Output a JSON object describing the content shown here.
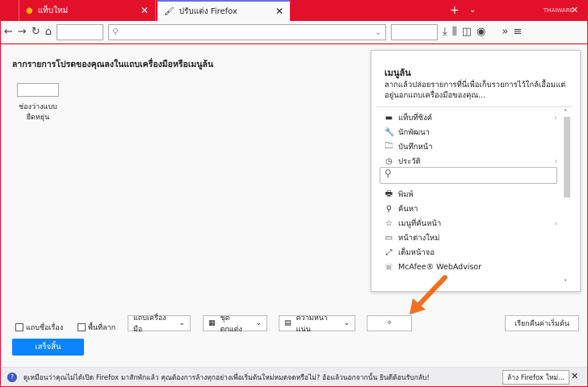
{
  "tabs": [
    {
      "label": "แท็บใหม่",
      "icon": "firefox-icon"
    },
    {
      "label": "ปรับแต่ง Firefox",
      "icon": "brush-icon"
    }
  ],
  "heading": "ลากรายการโปรดของคุณลงในแถบเครื่องมือหรือเมนูล้น",
  "spacer_label": "ช่องว่างแบบยืดหยุ่น",
  "overflow": {
    "title": "เมนูล้น",
    "description": "ลากแล้วปล่อยรายการที่นี่เพื่อเก็บรายการไว้ใกล้เอื้อมแต่อยู่นอกแถบเครื่องมือของคุณ...",
    "items": [
      {
        "label": "แท็บที่ซิงค์",
        "icon": "laptop-icon",
        "sub": true
      },
      {
        "label": "นักพัฒนา",
        "icon": "wrench-icon",
        "sub": false
      },
      {
        "label": "บันทึกหน้า",
        "icon": "save-page-icon",
        "sub": false
      },
      {
        "label": "ประวัติ",
        "icon": "clock-icon",
        "sub": true
      },
      {
        "label": "พิมพ์",
        "icon": "printer-icon",
        "sub": false
      },
      {
        "label": "ค้นหา",
        "icon": "search-icon",
        "sub": false
      },
      {
        "label": "เมนูที่คั่นหน้า",
        "icon": "bookmark-menu-icon",
        "sub": true
      },
      {
        "label": "หน้าต่างใหม่",
        "icon": "new-window-icon",
        "sub": false
      },
      {
        "label": "เต็มหน้าจอ",
        "icon": "fullscreen-icon",
        "sub": false
      },
      {
        "label": "McAfee® WebAdvisor",
        "icon": "mcafee-icon",
        "sub": false
      }
    ]
  },
  "bottom": {
    "title_bar": "แถบชื่อเรื่อง",
    "drag_space": "พื้นที่ลาก",
    "toolbars": "แถบเครื่องมือ",
    "themes": "ชุดตกแต่ง",
    "density": "ความหนาแน่น",
    "restore": "เรียกคืนค่าเริ่มต้น",
    "done": "เสร็จสิ้น"
  },
  "notification": {
    "text": "ดูเหมือนว่าคุณไม่ได้เปิด Firefox มาสักพักแล้ว คุณต้องการล้างทุกอย่างเพื่อเริ่มต้นใหม่หมดจดหรือไม่? อ้อแล้วนอกจากนั้น ยินดีต้อนรับกลับ!",
    "button": "ล้าง Firefox ใหม่..."
  },
  "watermark": "THAIWARE",
  "colors": {
    "accent": "#0a84ff",
    "tabbar": "#e3102a",
    "arrow": "#f07020"
  }
}
